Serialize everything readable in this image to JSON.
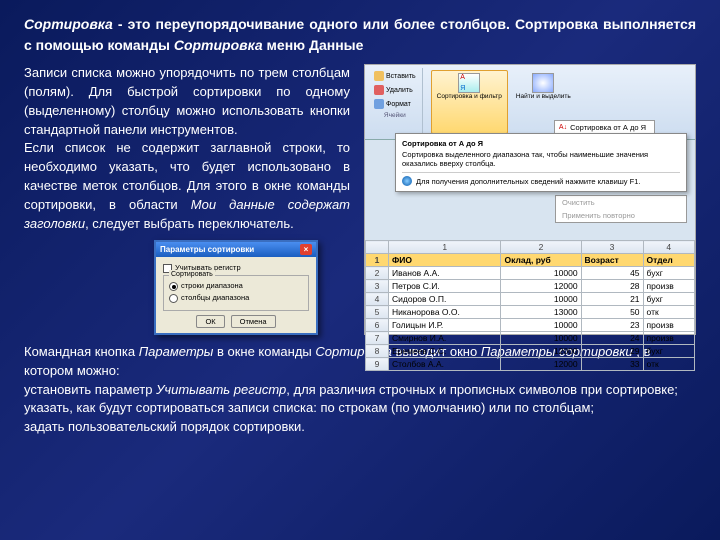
{
  "heading": {
    "t1_i": "Сортировка",
    "t1_n": " - это переупорядочивание одного или более столбцов. Сортировка выполняется с помощью команды ",
    "t2_i": "Сортировка",
    "t2_n": " меню ",
    "t3": "Данные"
  },
  "para": {
    "p1": "Записи списка можно упорядочить по трем столбцам (полям). Для быстрой сортировки по одному (выделенному) столбцу можно использовать кнопки стандартной панели инструментов.",
    "p2a": "Если список не содержит заглавной строки, то необходимо указать, что будет использовано в качестве меток столбцов. Для этого в окне команды сортировки, в области ",
    "p2_i": "Мои данные содержат заголовки",
    "p2b": ", следует выбрать переключатель."
  },
  "ribbon": {
    "insert": "Вставить",
    "delete": "Удалить",
    "format": "Формат",
    "cells_grp": "Ячейки",
    "sort_filter": "Сортировка и фильтр",
    "find_select": "Найти и выделить",
    "sort_az": "Сортировка от А до Я"
  },
  "tooltip": {
    "head": "Сортировка от А до Я",
    "body": "Сортировка выделенного диапазона так, чтобы наименьшие значения оказались вверху столбца.",
    "f1": "Для получения дополнительных сведений нажмите клавишу F1."
  },
  "menu_under": {
    "m1": "Очистить",
    "m2": "Применить повторно"
  },
  "table": {
    "cols": [
      "",
      "1",
      "2",
      "3",
      "4"
    ],
    "header": [
      "ФИО",
      "Оклад, руб",
      "Возраст",
      "Отдел"
    ],
    "rows": [
      [
        "Иванов А.А.",
        "10000",
        "45",
        "бухг"
      ],
      [
        "Петров С.И.",
        "12000",
        "28",
        "произв"
      ],
      [
        "Сидоров О.П.",
        "10000",
        "21",
        "бухг"
      ],
      [
        "Никанорова О.О.",
        "13000",
        "50",
        "отк"
      ],
      [
        "Голицын И.Р.",
        "10000",
        "23",
        "произв"
      ],
      [
        "Смирнов И.А.",
        "10000",
        "24",
        "произв"
      ],
      [
        "Еремеев С.С.",
        "12000",
        "29",
        "бухг"
      ],
      [
        "Столбов А.А.",
        "12000",
        "33",
        "отк"
      ]
    ]
  },
  "dialog": {
    "title": "Параметры сортировки",
    "chk": "Учитывать регистр",
    "grp": "Сортировать",
    "opt1": "строки диапазона",
    "opt2": "столбцы диапазона",
    "ok": "ОК",
    "cancel": "Отмена"
  },
  "bottom": {
    "b1a": "Командная кнопка ",
    "b1_i1": "Параметры",
    "b1b": " в окне команды ",
    "b1_i2": "Сортировка",
    "b1c": " выводит окно ",
    "b1_i3": "Параметры сортировки ",
    "b1d": ", в котором можно:",
    "b2a": "установить параметр ",
    "b2_i": "Учитывать регистр",
    "b2b": ", для различия строчных и прописных символов при сортировке;",
    "b3": "указать, как будут сортироваться записи списка: по строкам (по умолчанию) или по столбцам;",
    "b4": "задать пользовательский порядок сортировки."
  }
}
